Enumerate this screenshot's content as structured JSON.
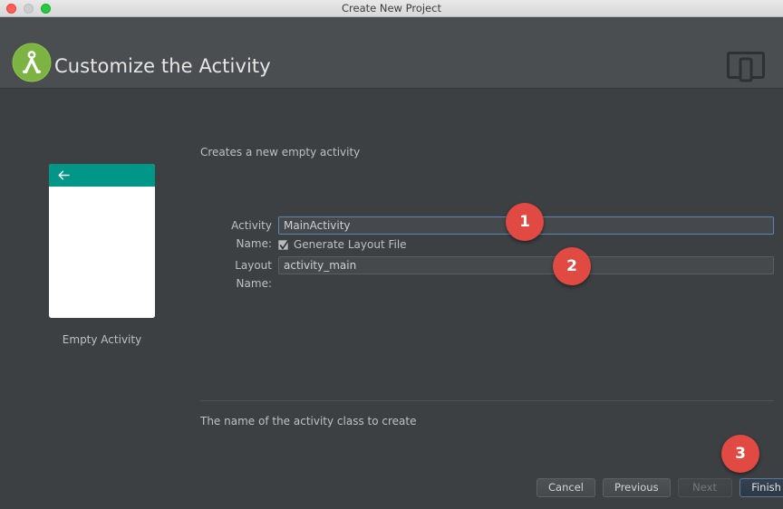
{
  "window": {
    "title": "Create New Project",
    "controls": {
      "close": "close-button",
      "minimize": "minimize-button",
      "maximize": "maximize-button"
    }
  },
  "header": {
    "title": "Customize the Activity",
    "logo_icon": "android-studio-logo-icon",
    "device_icon": "device-form-factor-icon"
  },
  "preview": {
    "label": "Empty Activity",
    "back_arrow_icon": "back-arrow-icon",
    "app_bar_color": "#009688",
    "body_color": "#ffffff"
  },
  "form": {
    "description": "Creates a new empty activity",
    "activity_name": {
      "label": "Activity Name:",
      "value": "MainActivity",
      "placeholder": "MainActivity"
    },
    "generate_layout": {
      "label": "Generate Layout File",
      "checked": "true",
      "check_icon": "checkmark-icon"
    },
    "layout_name": {
      "label": "Layout Name:",
      "value": "activity_main",
      "placeholder": "activity_main"
    },
    "help_text": "The name of the activity class to create"
  },
  "buttons": {
    "cancel": "Cancel",
    "previous": "Previous",
    "next": "Next",
    "finish": "Finish"
  },
  "annotations": {
    "one": "1",
    "two": "2",
    "three": "3",
    "color": "#e04a43"
  }
}
